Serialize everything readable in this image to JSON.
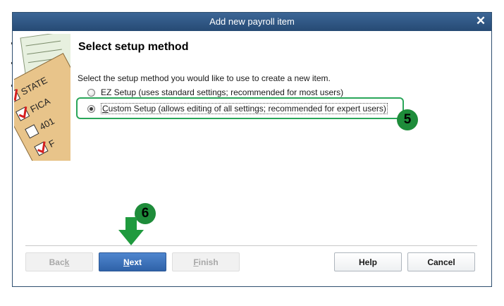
{
  "window": {
    "title": "Add new payroll item"
  },
  "page": {
    "heading": "Select setup method",
    "instruction": "Select the setup method you would like to use to create a new item."
  },
  "options": {
    "ez": {
      "label": "EZ Setup (uses standard settings; recommended for most users)",
      "selected": false
    },
    "custom": {
      "mnemonic": "C",
      "label_rest": "ustom Setup (allows editing of all settings; recommended for expert users)",
      "selected": true
    }
  },
  "annotations": {
    "step5": "5",
    "step6": "6",
    "accent_color": "#2aa65a"
  },
  "illustration": {
    "labels": [
      "STATE",
      "FICA",
      "401",
      "F"
    ]
  },
  "buttons": {
    "back": {
      "pre": "Bac",
      "mnemonic": "k",
      "post": "",
      "enabled": false
    },
    "next": {
      "pre": "",
      "mnemonic": "N",
      "post": "ext",
      "enabled": true
    },
    "finish": {
      "pre": "",
      "mnemonic": "F",
      "post": "inish",
      "enabled": false
    },
    "help": {
      "label": "Help"
    },
    "cancel": {
      "label": "Cancel"
    }
  }
}
